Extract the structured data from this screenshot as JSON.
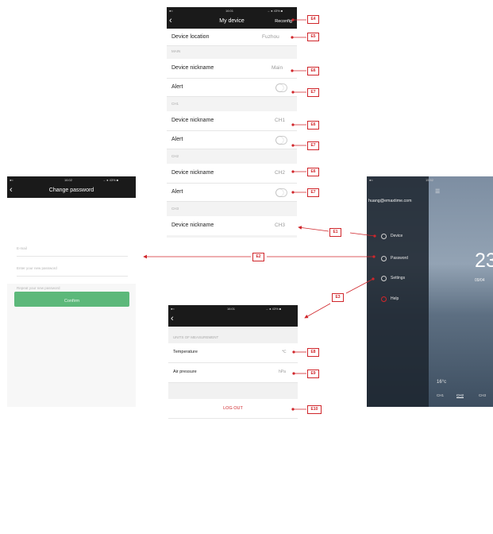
{
  "device_screen": {
    "status_time": "16:01",
    "status_right": "→ ● 43% ■",
    "title": "My device",
    "action": "Reconfig",
    "location_label": "Device location",
    "location_value": "Fuzhou",
    "sections": [
      {
        "header": "MAIN",
        "nickname_label": "Device nickname",
        "nickname_value": "Main",
        "alert_label": "Alert"
      },
      {
        "header": "CH1",
        "nickname_label": "Device nickname",
        "nickname_value": "CH1",
        "alert_label": "Alert"
      },
      {
        "header": "CH2",
        "nickname_label": "Device nickname",
        "nickname_value": "CH2",
        "alert_label": "Alert"
      },
      {
        "header": "CH3",
        "nickname_label": "Device nickname",
        "nickname_value": "CH3"
      }
    ]
  },
  "password_screen": {
    "status_time": "16:02",
    "status_right": "→ ● 43% ■",
    "title": "Change password",
    "fields": [
      {
        "placeholder": "E-mail"
      },
      {
        "placeholder": "Enter your new password"
      },
      {
        "placeholder": "Repeat your new password"
      }
    ],
    "confirm_label": "Confirm",
    "confirm_color": "#5cb87a"
  },
  "settings_screen": {
    "status_time": "16:01",
    "status_right": "→ ● 43% ■",
    "section": "UNITS OF MEASUREMENT",
    "rows": [
      {
        "label": "Temperature",
        "value": "℃"
      },
      {
        "label": "Air pressure",
        "value": "hPa"
      }
    ],
    "logout_label": "LOG OUT",
    "logout_color": "#d0262b"
  },
  "menu_screen": {
    "status_time": "15:52",
    "email": "huang@emaxtime.com",
    "items": [
      {
        "label": "Device",
        "icon": "device-icon"
      },
      {
        "label": "Password",
        "icon": "lock-icon"
      },
      {
        "label": "Settings",
        "icon": "gear-icon"
      },
      {
        "label": "Help",
        "icon": "help-icon"
      }
    ],
    "big_number": "23",
    "date": "09/04",
    "small_temp": "16°c",
    "tabs": [
      "CH1",
      "CH2",
      "CH3"
    ]
  },
  "callouts": {
    "E1": "E1",
    "E2": "E2",
    "E3": "E3",
    "E4": "E4",
    "E5": "E5",
    "E6": "E6",
    "E7": "E7",
    "E8": "E8",
    "E9": "E9",
    "E10": "E10"
  },
  "accent_color": "#d0262b"
}
